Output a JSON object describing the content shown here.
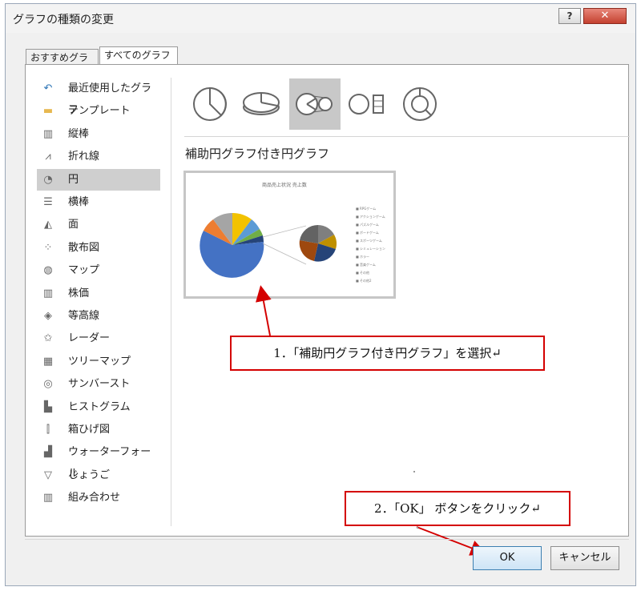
{
  "window": {
    "title": "グラフの種類の変更",
    "help_label": "?",
    "close_label": "✕"
  },
  "tabs": [
    {
      "label": "おすすめグラフ"
    },
    {
      "label": "すべてのグラフ"
    }
  ],
  "sidebar": {
    "selected_index": 4,
    "items": [
      {
        "label": "最近使用したグラフ",
        "icon": "undo-icon"
      },
      {
        "label": "テンプレート",
        "icon": "folder-icon"
      },
      {
        "label": "縦棒",
        "icon": "column-chart-icon"
      },
      {
        "label": "折れ線",
        "icon": "line-chart-icon"
      },
      {
        "label": "円",
        "icon": "pie-chart-icon"
      },
      {
        "label": "横棒",
        "icon": "bar-chart-icon"
      },
      {
        "label": "面",
        "icon": "area-chart-icon"
      },
      {
        "label": "散布図",
        "icon": "scatter-chart-icon"
      },
      {
        "label": "マップ",
        "icon": "map-chart-icon"
      },
      {
        "label": "株価",
        "icon": "stock-chart-icon"
      },
      {
        "label": "等高線",
        "icon": "surface-chart-icon"
      },
      {
        "label": "レーダー",
        "icon": "radar-chart-icon"
      },
      {
        "label": "ツリーマップ",
        "icon": "treemap-chart-icon"
      },
      {
        "label": "サンバースト",
        "icon": "sunburst-chart-icon"
      },
      {
        "label": "ヒストグラム",
        "icon": "histogram-chart-icon"
      },
      {
        "label": "箱ひげ図",
        "icon": "box-whisker-chart-icon"
      },
      {
        "label": "ウォーターフォール",
        "icon": "waterfall-chart-icon"
      },
      {
        "label": "じょうご",
        "icon": "funnel-chart-icon"
      },
      {
        "label": "組み合わせ",
        "icon": "combo-chart-icon"
      }
    ]
  },
  "subtypes": [
    {
      "icon": "pie-subtype-icon"
    },
    {
      "icon": "3d-pie-subtype-icon"
    },
    {
      "icon": "pie-of-pie-subtype-icon",
      "selected": true
    },
    {
      "icon": "bar-of-pie-subtype-icon"
    },
    {
      "icon": "doughnut-subtype-icon"
    }
  ],
  "selected_chart_name": "補助円グラフ付き円グラフ",
  "preview": {
    "chart_title": "商品売上状況 売上数",
    "legend_items": [
      "■ RPGゲーム",
      "■ アクションゲーム",
      "■ パズルゲーム",
      "■ ボードゲーム",
      "■ スポーツゲーム",
      "■ シミュレーション",
      "■ ホラー",
      "■ 音楽ゲーム",
      "■ その他",
      "■ その他2"
    ]
  },
  "colors": {
    "callout_border": "#d40000",
    "selection_bg": "#cfcfcf",
    "ok_border": "#3c7fb1"
  },
  "callouts": {
    "step1": "1．「補助円グラフ付き円グラフ」を選択↵",
    "step2": "2．「OK」 ボタンをクリック↵"
  },
  "buttons": {
    "ok": "OK",
    "cancel": "キャンセル"
  }
}
